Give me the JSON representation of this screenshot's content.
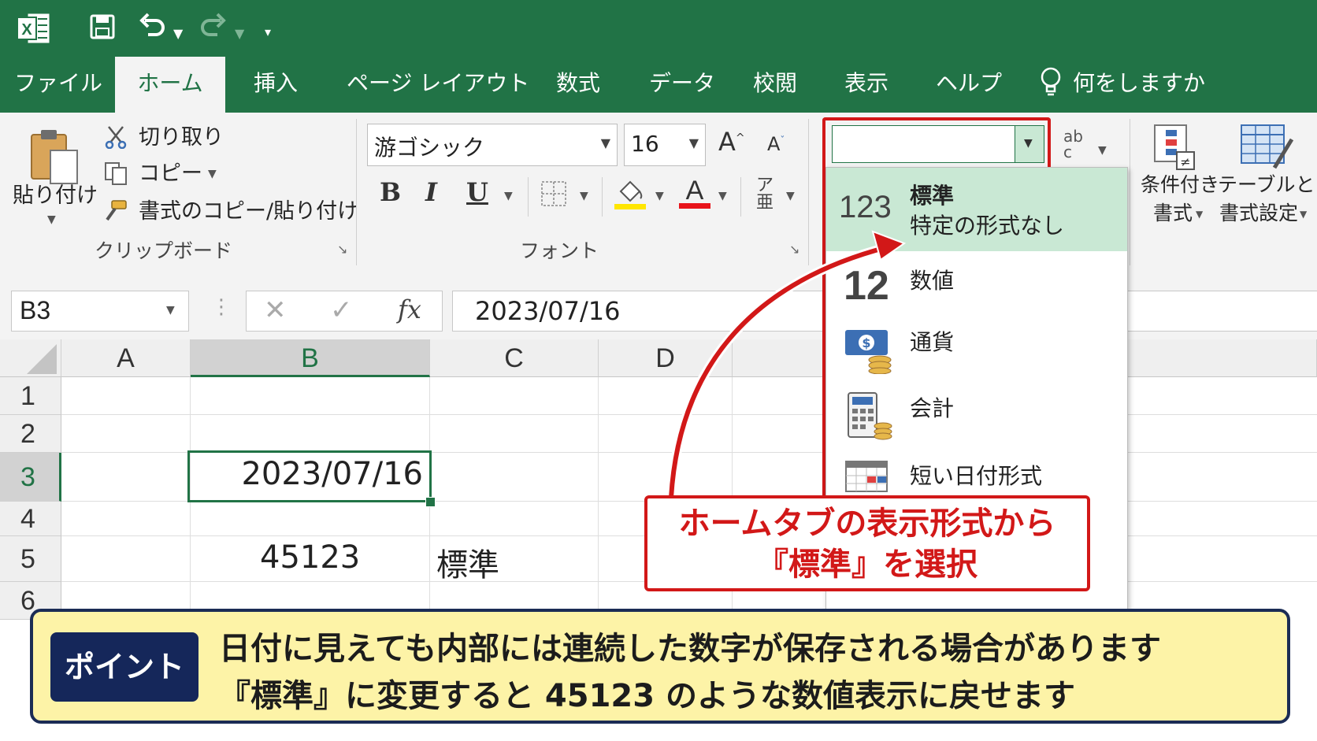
{
  "colors": {
    "excel_green": "#217346",
    "ribbon_bg": "#f3f3f3",
    "selected_item": "#c9e8d4",
    "callout_red": "#d21818",
    "note_bg": "#fdf3a7",
    "note_border": "#1b2c55"
  },
  "quick_access": {
    "icons": [
      "excel-logo-icon",
      "save-icon",
      "undo-icon",
      "redo-icon",
      "customize-icon"
    ]
  },
  "tabs": [
    "ファイル",
    "ホーム",
    "挿入",
    "ページ レイアウト",
    "数式",
    "データ",
    "校閲",
    "表示",
    "ヘルプ"
  ],
  "active_tab": "ホーム",
  "tell_me": "何をしますか",
  "clipboard": {
    "paste": "貼り付け",
    "cut": "切り取り",
    "copy": "コピー",
    "format_painter": "書式のコピー/貼り付け",
    "group_label": "クリップボード"
  },
  "font": {
    "name": "游ゴシック",
    "size": "16",
    "group_label": "フォント",
    "bold": "B",
    "italic": "I",
    "underline": "U"
  },
  "number_format": {
    "current": ""
  },
  "styles": {
    "conditional_line1": "条件付き",
    "conditional_line2": "書式",
    "table_line1": "テーブルとして",
    "table_line2": "書式設定"
  },
  "formula_bar": {
    "name_box": "B3",
    "fx": "fx",
    "formula": "2023/07/16"
  },
  "columns": [
    "A",
    "B",
    "C",
    "D"
  ],
  "rows": [
    "1",
    "2",
    "3",
    "4",
    "5",
    "6"
  ],
  "cells": {
    "B3": "2023/07/16",
    "B5": "45123",
    "C5": "標準"
  },
  "dropdown_items": [
    {
      "icon_text": "123",
      "label": "標準",
      "sublabel": "特定の形式なし",
      "selected": true
    },
    {
      "icon_text": "12",
      "label": "数値"
    },
    {
      "label": "通貨"
    },
    {
      "label": "会計"
    },
    {
      "label": "短い日付形式"
    }
  ],
  "callout": {
    "line1": "ホームタブの表示形式から",
    "line2": "『標準』を選択"
  },
  "note": {
    "badge": "ポイント",
    "line1": "日付に見えても内部には連続した数字が保存される場合があります",
    "line2": "『標準』に変更すると 45123 のような数値表示に戻せます"
  }
}
